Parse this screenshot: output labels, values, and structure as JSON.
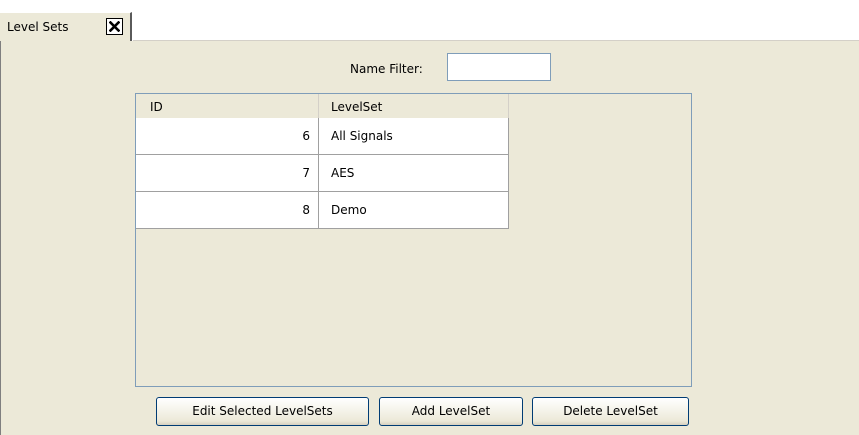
{
  "tab": {
    "label": "Level Sets",
    "close_icon": "close-icon"
  },
  "filter": {
    "label": "Name Filter:",
    "value": ""
  },
  "table": {
    "columns": [
      "ID",
      "LevelSet"
    ],
    "rows": [
      {
        "id": "6",
        "levelset": "All Signals"
      },
      {
        "id": "7",
        "levelset": "AES"
      },
      {
        "id": "8",
        "levelset": "Demo"
      }
    ]
  },
  "buttons": {
    "edit": "Edit Selected LevelSets",
    "add": "Add LevelSet",
    "delete": "Delete LevelSet"
  }
}
